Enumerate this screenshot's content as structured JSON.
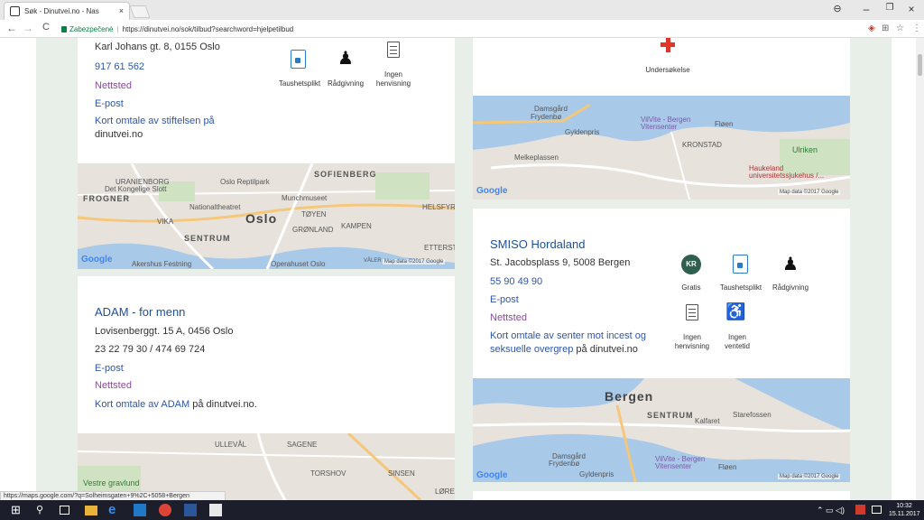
{
  "browser": {
    "tab_title": "Søk - Dinutvei.no - Nas",
    "tab_close": "×",
    "secure_label": "Zabezpečené",
    "url": "https://dinutvei.no/sok/tilbud?searchword=hjelpetilbud",
    "status_url": "https://maps.google.com/?q=Solheimsgaten+9%2C+5058+Bergen",
    "win_min": "–",
    "win_max": "❐",
    "win_close": "×",
    "nav_back": "←",
    "nav_forward": "→",
    "nav_reload": "C",
    "star": "☆",
    "menu": "⋮"
  },
  "left_card_1": {
    "address": "Karl Johans gt. 8, 0155 Oslo",
    "phone": "917 61 562",
    "website": "Nettsted",
    "email": "E-post",
    "desc_link": "Kort omtale av stiftelsen på",
    "desc_rest": "dinutvei.no",
    "icons": [
      {
        "label": "Taushetsplikt",
        "icon": "lock-document-icon"
      },
      {
        "label": "Rådgivning",
        "icon": "person-icon"
      },
      {
        "label1": "Ingen",
        "label2": "henvisning",
        "icon": "document-icon"
      }
    ],
    "map": {
      "labels": [
        "URANIENBORG",
        "Det Kongelige Slott",
        "Oslo Reptilpark",
        "SOFIENBERG",
        "FROGNER",
        "Munchmuseet",
        "Nationaltheatret",
        "TØYEN",
        "HELSFYR",
        "Oslo",
        "VIKA",
        "GRØNLAND",
        "KAMPEN",
        "SENTRUM",
        "ETTERSTAD",
        "Akershus Festning",
        "Operahuset Oslo",
        "VÅLER"
      ],
      "google": "Google",
      "mapdata": "Map data ©2017 Google"
    }
  },
  "left_card_2": {
    "title": "ADAM - for menn",
    "address": "Lovisenberggt. 15 A, 0456 Oslo",
    "phone": "23 22 79 30 / 474 69 724",
    "email": "E-post",
    "website": "Nettsted",
    "desc_link": "Kort omtale av ADAM",
    "desc_rest": "på dinutvei.no.",
    "map": {
      "labels": [
        "ULLEVÅL",
        "SAGENE",
        "Vestre gravlund",
        "TORSHOV",
        "SINSEN",
        "LØREN"
      ]
    }
  },
  "right_card_1": {
    "icon_label": "Undersøkelse",
    "map": {
      "labels": [
        "Damsgård",
        "Frydenbø",
        "VilVite - Bergen Vitensenter",
        "Fløen",
        "Gyldenpris",
        "KRONSTAD",
        "Ulriken",
        "Melkeplassen",
        "Haukeland universitetssjukehus /..."
      ],
      "google": "Google",
      "mapdata": "Map data ©2017 Google"
    }
  },
  "right_card_2": {
    "title": "SMISO Hordaland",
    "address": "St. Jacobsplass 9, 5008 Bergen",
    "phone": "55 90 49 90",
    "email": "E-post",
    "website": "Nettsted",
    "desc_link1": "Kort omtale av senter mot incest og",
    "desc_link2": "seksuelle overgrep",
    "desc_rest": "på dinutvei.no",
    "icons": [
      {
        "label": "Gratis",
        "badge": "KR",
        "icon": "kr-badge-icon"
      },
      {
        "label": "Taushetsplikt",
        "icon": "lock-document-icon"
      },
      {
        "label": "Rådgivning",
        "icon": "person-icon"
      },
      {
        "label1": "Ingen",
        "label2": "henvisning",
        "icon": "document-icon"
      },
      {
        "label1": "Ingen",
        "label2": "ventetid",
        "icon": "waiting-icon"
      }
    ],
    "map": {
      "labels": [
        "Bergen",
        "SENTRUM",
        "Kalfaret",
        "Starefossen",
        "Damsgård",
        "Frydenbø",
        "VilVite - Bergen Vitensenter",
        "Fløen",
        "Gyldenpris"
      ],
      "google": "Google",
      "mapdata": "Map data ©2017 Google"
    }
  },
  "taskbar": {
    "time": "10:32",
    "date": "15.11.2017"
  }
}
